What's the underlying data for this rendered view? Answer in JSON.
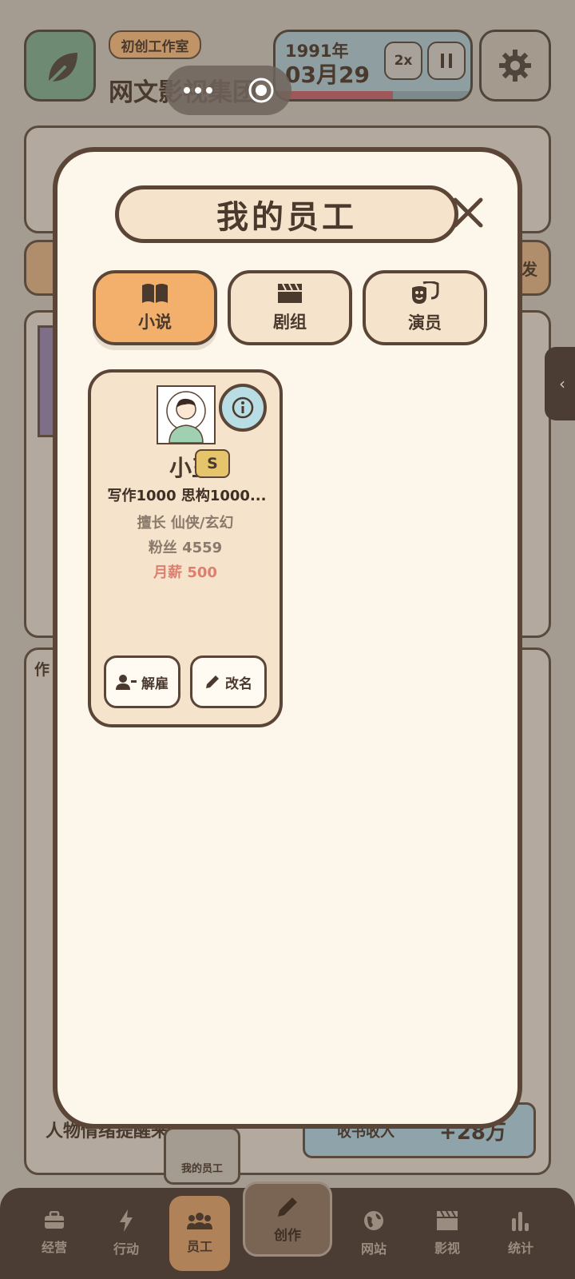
{
  "header": {
    "studio_badge": "初创工作室",
    "company_name": "网文影视集团",
    "year": "1991年",
    "date": "03月29",
    "speed": "2x",
    "progress": 0.6
  },
  "background": {
    "right_tag": "发",
    "footer_partial_text": "人物情绪提醒来了。",
    "income_label": "收书收入",
    "income_value": "+28万",
    "section_initial": "作",
    "my_staff_label": "我的员工"
  },
  "modal": {
    "title": "我的员工",
    "tabs": [
      {
        "label": "小说",
        "icon": "open-book-icon",
        "active": true
      },
      {
        "label": "剧组",
        "icon": "clapperboard-icon",
        "active": false
      },
      {
        "label": "演员",
        "icon": "theater-masks-icon",
        "active": false
      }
    ],
    "employee": {
      "name": "小王",
      "grade": "S",
      "stats": "写作1000  思构1000...",
      "specialty": "擅长 仙侠/玄幻",
      "fans": "粉丝 4559",
      "salary": "月薪 500",
      "fire_label": "解雇",
      "rename_label": "改名"
    }
  },
  "nav": {
    "items": [
      {
        "label": "经营",
        "icon": "briefcase-icon"
      },
      {
        "label": "行动",
        "icon": "lightning-icon"
      },
      {
        "label": "员工",
        "icon": "people-icon",
        "active": true
      },
      {
        "label": "创作",
        "icon": "pencil-icon"
      },
      {
        "label": "网站",
        "icon": "globe-icon"
      },
      {
        "label": "影视",
        "icon": "film-icon"
      },
      {
        "label": "统计",
        "icon": "bar-chart-icon"
      }
    ]
  },
  "colors": {
    "accent_orange": "#f2b06c",
    "cream": "#fdf6ea",
    "card_bg": "#f6e3cb",
    "border_brown": "#5a4536",
    "salary_red": "#dd7f6f",
    "info_blue": "#b8dde5",
    "grade_gold": "#e6c46b"
  }
}
